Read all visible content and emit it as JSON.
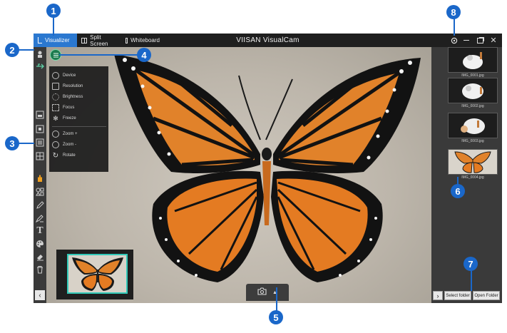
{
  "tabs": [
    {
      "label": "Visualizer",
      "active": true
    },
    {
      "label": "Split Screen",
      "active": false
    },
    {
      "label": "Whiteboard",
      "active": false
    }
  ],
  "app_title": "VIISAN VisualCam",
  "window_controls": [
    "settings-icon",
    "minimize-icon",
    "restore-icon",
    "close-icon"
  ],
  "left_tools": [
    "camera-icon",
    "usb-icon",
    "layout-icon",
    "stop-icon",
    "square-icon",
    "grid-icon",
    "hand-icon",
    "shapes-icon",
    "pen-icon",
    "highlighter-icon",
    "text-icon",
    "palette-icon",
    "eraser-icon",
    "trash-icon"
  ],
  "camera_menu": {
    "items": [
      {
        "label": "Device",
        "icon": "device-icon"
      },
      {
        "label": "Resolution",
        "icon": "resolution-icon"
      },
      {
        "label": "Brightness",
        "icon": "brightness-icon"
      },
      {
        "label": "Focus",
        "icon": "focus-icon"
      },
      {
        "label": "Freeze",
        "icon": "freeze-icon"
      },
      {
        "label": "Zoom +",
        "icon": "zoom-in-icon"
      },
      {
        "label": "Zoom -",
        "icon": "zoom-out-icon"
      },
      {
        "label": "Rotate",
        "icon": "rotate-icon"
      }
    ]
  },
  "gallery": [
    {
      "caption": "IMG_0001.jpg"
    },
    {
      "caption": "IMG_0002.jpg"
    },
    {
      "caption": "IMG_0003.jpg"
    },
    {
      "caption": "IMG_0004.jpg"
    }
  ],
  "buttons": {
    "select_folder": "Select folder",
    "open_folder": "Open Folder"
  },
  "callouts": [
    "1",
    "2",
    "3",
    "4",
    "5",
    "6",
    "7",
    "8"
  ],
  "colors": {
    "accent": "#1a67c9",
    "active_tab": "#2b78d0",
    "menu_button": "#1d7a4f",
    "preview_border": "#31c9b8"
  }
}
